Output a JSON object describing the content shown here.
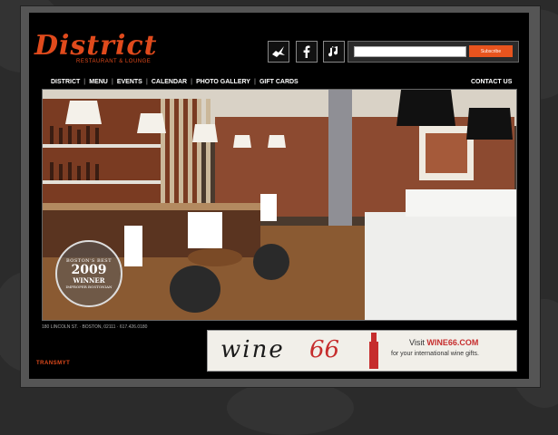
{
  "brand": {
    "name": "District",
    "subtitle": "RESTAURANT & LOUNGE",
    "accent": "#e04a1c"
  },
  "social": [
    {
      "name": "twitter-icon",
      "label": "Twitter"
    },
    {
      "name": "facebook-icon",
      "label": "Facebook"
    },
    {
      "name": "myspace-icon",
      "label": "Music"
    }
  ],
  "subscribe": {
    "placeholder": "",
    "button_label": "Subscribe"
  },
  "nav": {
    "items": [
      "DISTRICT",
      "MENU",
      "EVENTS",
      "CALENDAR",
      "PHOTO GALLERY",
      "GIFT CARDS"
    ],
    "contact": "CONTACT US"
  },
  "hero": {
    "badge_top": "BOSTON'S BEST",
    "badge_year": "2009",
    "badge_win": "WINNER",
    "badge_bottom": "IMPROPER BOSTONIAN"
  },
  "footer": {
    "address": "180 LINCOLN ST. · BOSTON, 02111 · 617.426.0180",
    "credit": "TRANSMYT"
  },
  "ad": {
    "wine": "wine",
    "num": "66",
    "visit_prefix": "Visit ",
    "visit_site": "WINE66.COM",
    "tagline": "for your international wine gifts."
  }
}
